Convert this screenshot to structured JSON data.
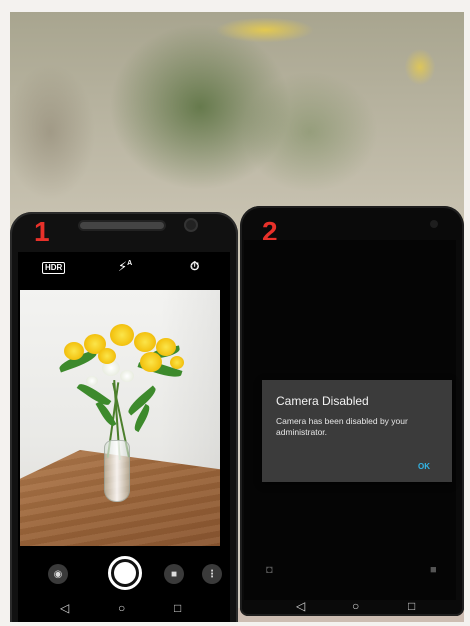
{
  "phones": [
    {
      "number_label": "1"
    },
    {
      "number_label": "2"
    }
  ],
  "camera_app": {
    "hdr_label": "HDR",
    "flash_label": "A"
  },
  "dialog": {
    "title": "Camera Disabled",
    "message": "Camera has been disabled by your administrator.",
    "ok_label": "OK"
  },
  "icons": {
    "nav": [
      "back-triangle-icon",
      "home-circle-icon",
      "recents-square-icon"
    ],
    "camera": [
      "hdr-icon",
      "flash-auto-icon",
      "timer-icon",
      "switch-camera-icon",
      "shutter-icon",
      "video-icon",
      "more-icon"
    ]
  },
  "colors": {
    "phone_number_red": "#e8312a",
    "dialog_background": "#3b3b3b",
    "dialog_ok_blue": "#33b5e5"
  }
}
